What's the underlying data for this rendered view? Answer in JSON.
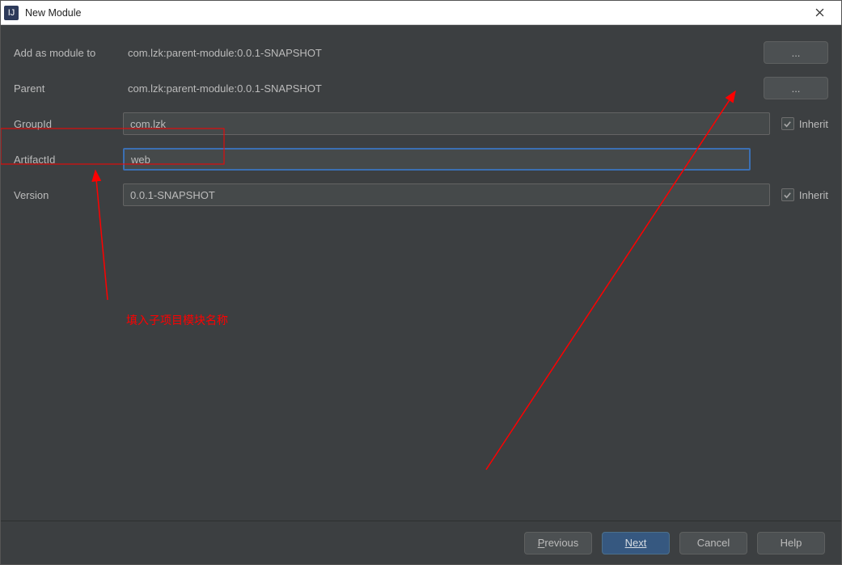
{
  "window": {
    "title": "New Module"
  },
  "form": {
    "addAsModuleTo": {
      "label": "Add as module to",
      "value": "com.lzk:parent-module:0.0.1-SNAPSHOT",
      "browse": "..."
    },
    "parent": {
      "label": "Parent",
      "value": "com.lzk:parent-module:0.0.1-SNAPSHOT",
      "browse": "..."
    },
    "groupId": {
      "label": "GroupId",
      "value": "com.lzk",
      "inherit": "Inherit"
    },
    "artifactId": {
      "label": "ArtifactId",
      "value": "web"
    },
    "version": {
      "label": "Version",
      "value": "0.0.1-SNAPSHOT",
      "inherit": "Inherit"
    }
  },
  "buttons": {
    "previous": "Previous",
    "next": "Next",
    "cancel": "Cancel",
    "help": "Help"
  },
  "annotations": {
    "artifactNote": "填入子项目模块名称"
  }
}
